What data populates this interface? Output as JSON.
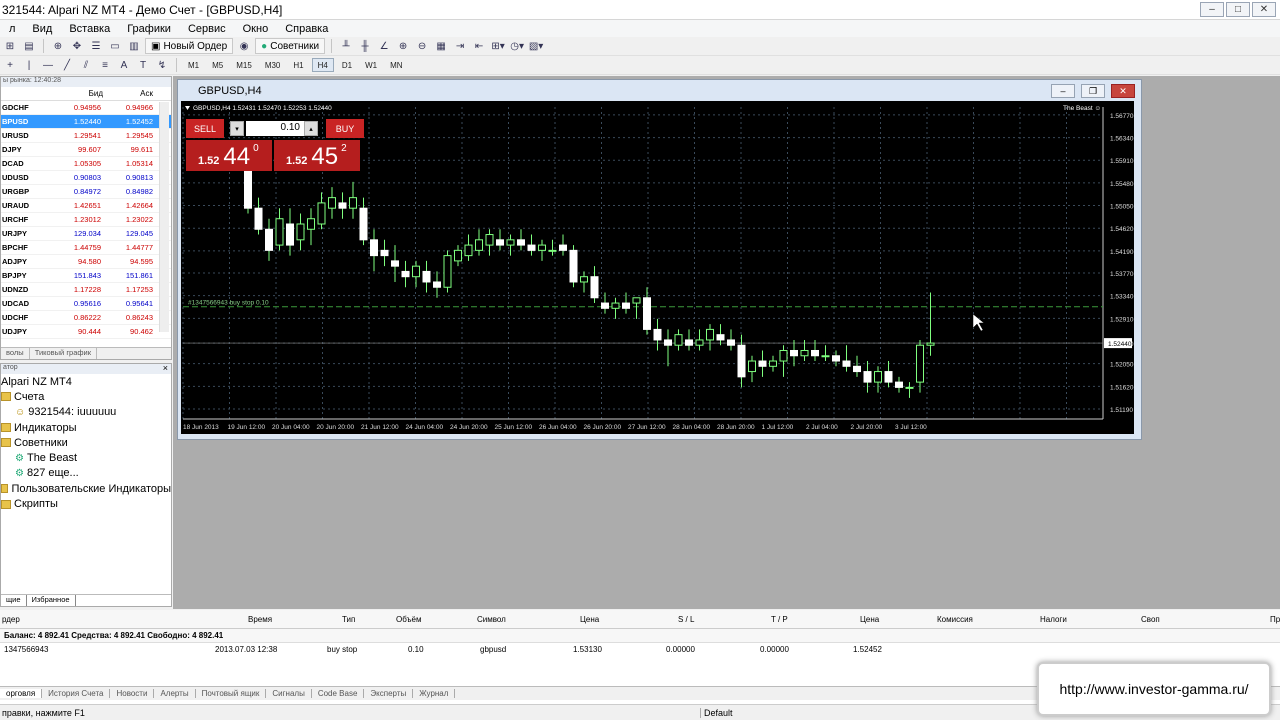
{
  "window": {
    "title": "321544: Alpari NZ MT4 - Демо Счет - [GBPUSD,H4]"
  },
  "menu": [
    "л",
    "Вид",
    "Вставка",
    "Графики",
    "Сервис",
    "Окно",
    "Справка"
  ],
  "toolbar": {
    "new_order": "Новый Ордер",
    "experts": "Советники",
    "timeframes": [
      "M1",
      "M5",
      "M15",
      "M30",
      "H1",
      "H4",
      "D1",
      "W1",
      "MN"
    ],
    "active_tf": "H4"
  },
  "market_watch": {
    "header": "ы рынка: 12:40:28",
    "col_bid": "Бид",
    "col_ask": "Аск",
    "rows": [
      {
        "sym": "GDCHF",
        "bid": "0.94956",
        "ask": "0.94966",
        "style": "red"
      },
      {
        "sym": "BPUSD",
        "bid": "1.52440",
        "ask": "1.52452",
        "style": "sel"
      },
      {
        "sym": "URUSD",
        "bid": "1.29541",
        "ask": "1.29545",
        "style": "red"
      },
      {
        "sym": "DJPY",
        "bid": "99.607",
        "ask": "99.611",
        "style": "red"
      },
      {
        "sym": "DCAD",
        "bid": "1.05305",
        "ask": "1.05314",
        "style": "red"
      },
      {
        "sym": "UDUSD",
        "bid": "0.90803",
        "ask": "0.90813",
        "style": "blue"
      },
      {
        "sym": "URGBP",
        "bid": "0.84972",
        "ask": "0.84982",
        "style": "blue"
      },
      {
        "sym": "URAUD",
        "bid": "1.42651",
        "ask": "1.42664",
        "style": "red"
      },
      {
        "sym": "URCHF",
        "bid": "1.23012",
        "ask": "1.23022",
        "style": "red"
      },
      {
        "sym": "URJPY",
        "bid": "129.034",
        "ask": "129.045",
        "style": "blue"
      },
      {
        "sym": "BPCHF",
        "bid": "1.44759",
        "ask": "1.44777",
        "style": "red"
      },
      {
        "sym": "ADJPY",
        "bid": "94.580",
        "ask": "94.595",
        "style": "red"
      },
      {
        "sym": "BPJPY",
        "bid": "151.843",
        "ask": "151.861",
        "style": "blue"
      },
      {
        "sym": "UDNZD",
        "bid": "1.17228",
        "ask": "1.17253",
        "style": "red"
      },
      {
        "sym": "UDCAD",
        "bid": "0.95616",
        "ask": "0.95641",
        "style": "blue"
      },
      {
        "sym": "UDCHF",
        "bid": "0.86222",
        "ask": "0.86243",
        "style": "red"
      },
      {
        "sym": "UDJPY",
        "bid": "90.444",
        "ask": "90.462",
        "style": "red"
      }
    ],
    "tabs": [
      "волы",
      "Тиковый график"
    ]
  },
  "navigator": {
    "header": "атор",
    "items": [
      {
        "label": "Alpari NZ MT4",
        "indent": 0,
        "icon": "none"
      },
      {
        "label": "Счета",
        "indent": 0,
        "icon": "folder"
      },
      {
        "label": "9321544: iuuuuuu",
        "indent": 1,
        "icon": "account"
      },
      {
        "label": "Индикаторы",
        "indent": 0,
        "icon": "folder"
      },
      {
        "label": "Советники",
        "indent": 0,
        "icon": "folder"
      },
      {
        "label": "The Beast",
        "indent": 1,
        "icon": "expert"
      },
      {
        "label": "827 еще...",
        "indent": 1,
        "icon": "expert"
      },
      {
        "label": "Пользовательские Индикаторы",
        "indent": 0,
        "icon": "folder"
      },
      {
        "label": "Скрипты",
        "indent": 0,
        "icon": "folder"
      }
    ],
    "tabs": [
      "щие",
      "Избранное"
    ]
  },
  "chart_window": {
    "title": "GBPUSD,H4",
    "info": "GBPUSD,H4  1.52431 1.52470 1.52253 1.52440",
    "expert": "The Beast ☺",
    "order_label": "#1347566943 buy stop 0.10"
  },
  "one_click": {
    "sell": "SELL",
    "buy": "BUY",
    "lots": "0.10",
    "sell_small": "1.52",
    "sell_big": "44",
    "sell_sup": "0",
    "buy_small": "1.52",
    "buy_big": "45",
    "buy_sup": "2"
  },
  "chart_data": {
    "type": "candlestick",
    "symbol": "GBPUSD",
    "timeframe": "H4",
    "y_ticks": [
      "1.56770",
      "1.56340",
      "1.55910",
      "1.55480",
      "1.55050",
      "1.54620",
      "1.54190",
      "1.53770",
      "1.53340",
      "1.52910",
      "1.52440",
      "1.52050",
      "1.51620",
      "1.51190"
    ],
    "ylim": [
      1.51,
      1.5692
    ],
    "x_ticks": [
      "18 Jun 2013",
      "19 Jun 12:00",
      "20 Jun 04:00",
      "20 Jun 20:00",
      "21 Jun 12:00",
      "24 Jun 04:00",
      "24 Jun 20:00",
      "25 Jun 12:00",
      "26 Jun 04:00",
      "26 Jun 20:00",
      "27 Jun 12:00",
      "28 Jun 04:00",
      "28 Jun 20:00",
      "1 Jul 12:00",
      "2 Jul 04:00",
      "2 Jul 20:00",
      "3 Jul 12:00"
    ],
    "current_price": 1.5244,
    "buy_stop_price": 1.5313,
    "candles": [
      [
        1.557,
        1.558,
        1.549,
        1.55
      ],
      [
        1.55,
        1.552,
        1.545,
        1.546
      ],
      [
        1.546,
        1.548,
        1.54,
        1.542
      ],
      [
        1.543,
        1.55,
        1.542,
        1.548
      ],
      [
        1.547,
        1.55,
        1.541,
        1.543
      ],
      [
        1.544,
        1.549,
        1.542,
        1.547
      ],
      [
        1.546,
        1.55,
        1.543,
        1.548
      ],
      [
        1.547,
        1.553,
        1.546,
        1.551
      ],
      [
        1.55,
        1.554,
        1.548,
        1.552
      ],
      [
        1.551,
        1.553,
        1.548,
        1.55
      ],
      [
        1.55,
        1.555,
        1.548,
        1.552
      ],
      [
        1.55,
        1.552,
        1.543,
        1.544
      ],
      [
        1.544,
        1.546,
        1.538,
        1.541
      ],
      [
        1.542,
        1.544,
        1.539,
        1.541
      ],
      [
        1.54,
        1.543,
        1.536,
        1.539
      ],
      [
        1.538,
        1.54,
        1.535,
        1.537
      ],
      [
        1.537,
        1.54,
        1.535,
        1.539
      ],
      [
        1.538,
        1.54,
        1.534,
        1.536
      ],
      [
        1.536,
        1.538,
        1.533,
        1.535
      ],
      [
        1.535,
        1.542,
        1.534,
        1.541
      ],
      [
        1.54,
        1.543,
        1.539,
        1.542
      ],
      [
        1.541,
        1.545,
        1.54,
        1.543
      ],
      [
        1.542,
        1.546,
        1.541,
        1.544
      ],
      [
        1.543,
        1.546,
        1.541,
        1.545
      ],
      [
        1.544,
        1.546,
        1.542,
        1.543
      ],
      [
        1.543,
        1.545,
        1.541,
        1.544
      ],
      [
        1.544,
        1.546,
        1.542,
        1.543
      ],
      [
        1.543,
        1.545,
        1.541,
        1.542
      ],
      [
        1.542,
        1.544,
        1.54,
        1.543
      ],
      [
        1.542,
        1.544,
        1.541,
        1.542
      ],
      [
        1.543,
        1.545,
        1.541,
        1.542
      ],
      [
        1.542,
        1.543,
        1.535,
        1.536
      ],
      [
        1.536,
        1.538,
        1.534,
        1.537
      ],
      [
        1.537,
        1.539,
        1.532,
        1.533
      ],
      [
        1.532,
        1.534,
        1.53,
        1.531
      ],
      [
        1.531,
        1.533,
        1.529,
        1.532
      ],
      [
        1.532,
        1.534,
        1.53,
        1.531
      ],
      [
        1.532,
        1.533,
        1.529,
        1.533
      ],
      [
        1.533,
        1.535,
        1.526,
        1.527
      ],
      [
        1.527,
        1.529,
        1.523,
        1.525
      ],
      [
        1.525,
        1.527,
        1.52,
        1.524
      ],
      [
        1.524,
        1.527,
        1.523,
        1.526
      ],
      [
        1.525,
        1.527,
        1.523,
        1.524
      ],
      [
        1.524,
        1.527,
        1.523,
        1.525
      ],
      [
        1.525,
        1.528,
        1.523,
        1.527
      ],
      [
        1.526,
        1.528,
        1.524,
        1.525
      ],
      [
        1.525,
        1.527,
        1.523,
        1.524
      ],
      [
        1.524,
        1.526,
        1.516,
        1.518
      ],
      [
        1.519,
        1.522,
        1.517,
        1.521
      ],
      [
        1.521,
        1.523,
        1.518,
        1.52
      ],
      [
        1.52,
        1.522,
        1.519,
        1.521
      ],
      [
        1.521,
        1.524,
        1.518,
        1.523
      ],
      [
        1.523,
        1.525,
        1.52,
        1.522
      ],
      [
        1.522,
        1.525,
        1.521,
        1.523
      ],
      [
        1.523,
        1.525,
        1.521,
        1.522
      ],
      [
        1.522,
        1.524,
        1.521,
        1.522
      ],
      [
        1.522,
        1.523,
        1.52,
        1.521
      ],
      [
        1.521,
        1.524,
        1.519,
        1.52
      ],
      [
        1.52,
        1.522,
        1.518,
        1.519
      ],
      [
        1.519,
        1.521,
        1.515,
        1.517
      ],
      [
        1.517,
        1.52,
        1.515,
        1.519
      ],
      [
        1.519,
        1.521,
        1.516,
        1.517
      ],
      [
        1.517,
        1.518,
        1.515,
        1.516
      ],
      [
        1.516,
        1.517,
        1.514,
        1.516
      ],
      [
        1.517,
        1.525,
        1.515,
        1.524
      ],
      [
        1.524,
        1.534,
        1.522,
        1.5244
      ]
    ]
  },
  "terminal": {
    "headers": [
      "рдер",
      "Время",
      "Тип",
      "Объём",
      "Символ",
      "Цена",
      "S / L",
      "T / P",
      "Цена",
      "Комиссия",
      "Налоги",
      "Своп",
      "Пр"
    ],
    "balance": "Баланс: 4 892.41  Средства: 4 892.41  Свободно: 4 892.41",
    "order": [
      "1347566943",
      "2013.07.03 12:38",
      "buy stop",
      "0.10",
      "gbpusd",
      "1.53130",
      "0.00000",
      "0.00000",
      "1.52452"
    ],
    "tabs": [
      "орговля",
      "История Счета",
      "Новости",
      "Алерты",
      "Почтовый ящик",
      "Сигналы",
      "Code Base",
      "Эксперты",
      "Журнал"
    ]
  },
  "status": {
    "help": "правки, нажмите F1",
    "profile": "Default"
  },
  "banner": {
    "url": "http://www.investor-gamma.ru/"
  }
}
